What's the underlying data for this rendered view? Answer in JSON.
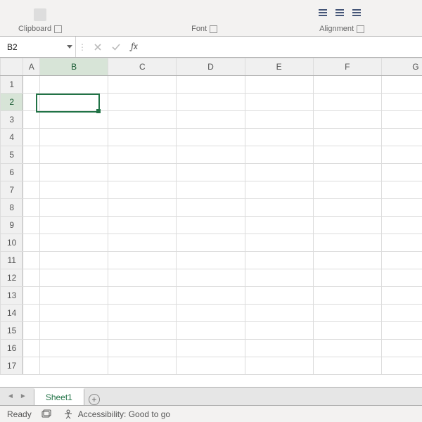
{
  "ribbon": {
    "groups": {
      "clipboard": {
        "label": "Clipboard"
      },
      "font": {
        "label": "Font"
      },
      "alignment": {
        "label": "Alignment"
      }
    }
  },
  "name_box": {
    "value": "B2"
  },
  "formula_bar": {
    "fx_label": "fx",
    "value": ""
  },
  "columns": [
    "A",
    "B",
    "C",
    "D",
    "E",
    "F",
    "G"
  ],
  "rows": [
    1,
    2,
    3,
    4,
    5,
    6,
    7,
    8,
    9,
    10,
    11,
    12,
    13,
    14,
    15,
    16,
    17
  ],
  "selection": {
    "col": "B",
    "row": 2
  },
  "sheet_tabs": {
    "active": "Sheet1",
    "tabs": [
      "Sheet1"
    ]
  },
  "status": {
    "ready": "Ready",
    "accessibility": "Accessibility: Good to go"
  }
}
